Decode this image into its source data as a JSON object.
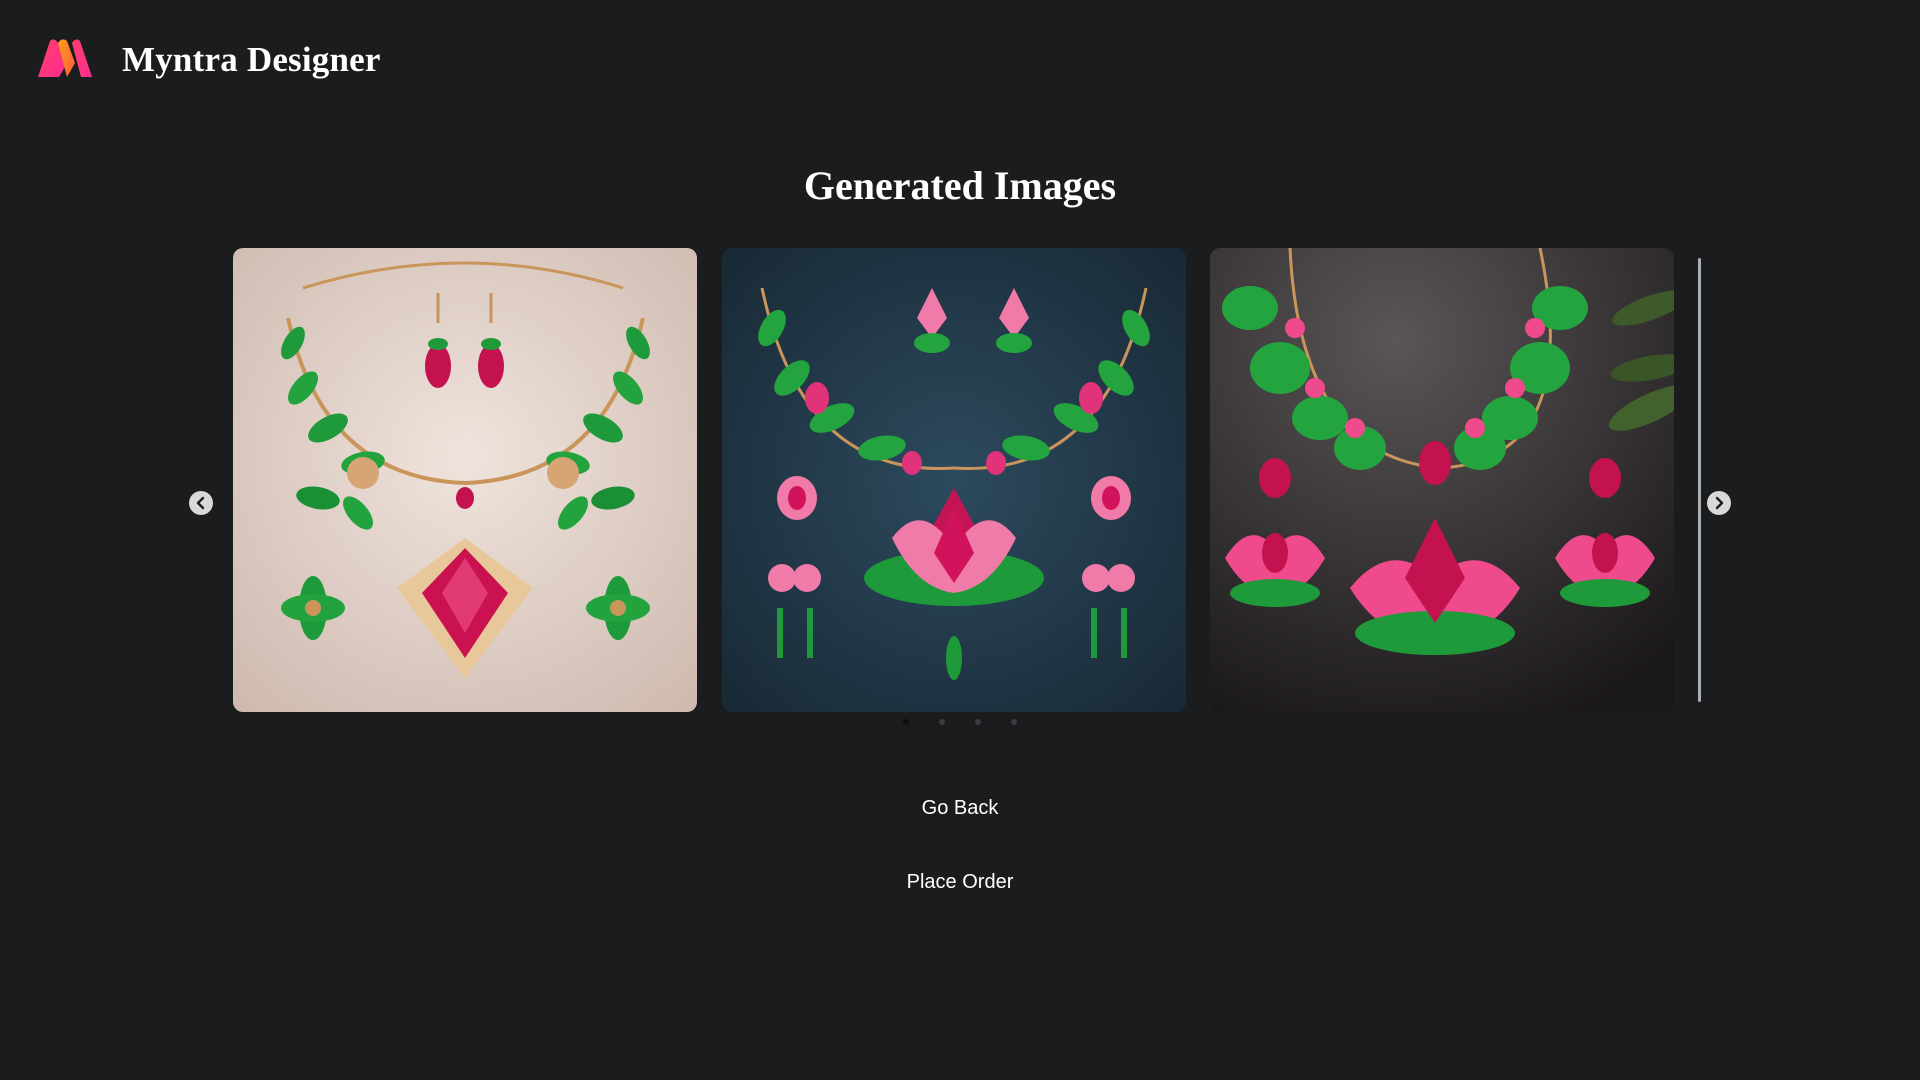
{
  "header": {
    "logo_icon": "myntra-m-logo-icon",
    "brand": "Myntra Designer"
  },
  "main": {
    "title": "Generated Images",
    "carousel": {
      "slides": [
        {
          "id": "slide-1",
          "background": "#e7d8d0"
        },
        {
          "id": "slide-2",
          "background": "#1f3545"
        },
        {
          "id": "slide-3",
          "background": "#2a2a2c"
        }
      ],
      "prev_icon": "chevron-left-icon",
      "next_icon": "chevron-right-icon",
      "dot_count": 4,
      "active_dot": 0
    },
    "actions": {
      "go_back": "Go Back",
      "place_order": "Place Order"
    }
  },
  "colors": {
    "background": "#1b1c1e",
    "text": "#ffffff",
    "logo_pink": "#ff3f6c",
    "logo_orange": "#ff9f1a",
    "gem_pink": "#d1135c",
    "leaf_green": "#1f9a3a",
    "gold": "#c9955a"
  }
}
